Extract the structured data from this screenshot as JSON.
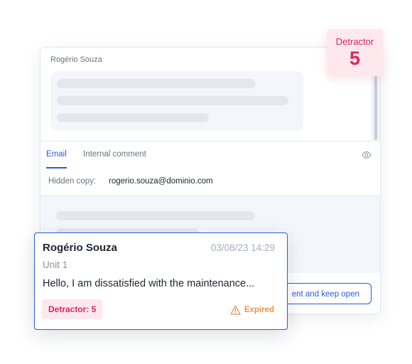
{
  "conversation": {
    "author": "Rogério Souza"
  },
  "tabs": [
    {
      "label": "Email",
      "active": true
    },
    {
      "label": "Internal comment",
      "active": false
    }
  ],
  "hidden_copy": {
    "label": "Hidden copy:",
    "value": "rogerio.souza@dominio.com"
  },
  "footer": {
    "send_label": "ent and keep open"
  },
  "score_badge": {
    "label": "Detractor",
    "value": "5"
  },
  "ticket": {
    "name": "Rogério Souza",
    "date": "03/08/23 14:29",
    "unit": "Unit 1",
    "message": "Hello, I am dissatisfied with the maintenance...",
    "tag": "Detractor: 5",
    "status": "Expired"
  },
  "icons": {
    "visibility": "eye-icon",
    "status": "warning-icon"
  },
  "colors": {
    "accent": "#2a5bd7",
    "detractor": "#e0245e",
    "detractor_bg": "#fde8ee",
    "expired": "#e8944c"
  }
}
